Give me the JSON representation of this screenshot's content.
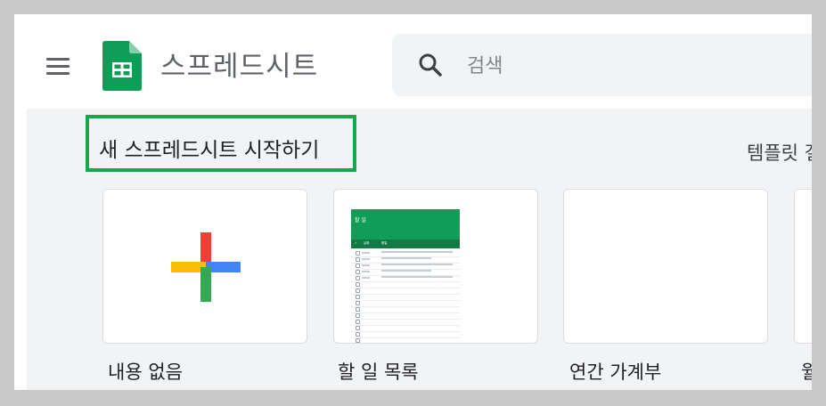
{
  "header": {
    "app_title": "스프레드시트",
    "search": {
      "placeholder": "검색",
      "value": ""
    }
  },
  "section": {
    "title": "새 스프레드시트 시작하기",
    "gallery_link": "템플릿 갤"
  },
  "templates": [
    {
      "label": "내용 없음"
    },
    {
      "label": "할 일 목록",
      "thumbnail": {
        "title": "할 일",
        "columns": [
          "✓",
          "날짜",
          "할일"
        ]
      }
    },
    {
      "label": "연간 가계부"
    },
    {
      "label": "월간"
    }
  ],
  "colors": {
    "sheets_green": "#0f9d58",
    "highlight_border": "#18a84b",
    "plus_red": "#ea4335",
    "plus_blue": "#4285f4",
    "plus_yellow": "#fbbc04",
    "plus_green": "#34a853"
  }
}
